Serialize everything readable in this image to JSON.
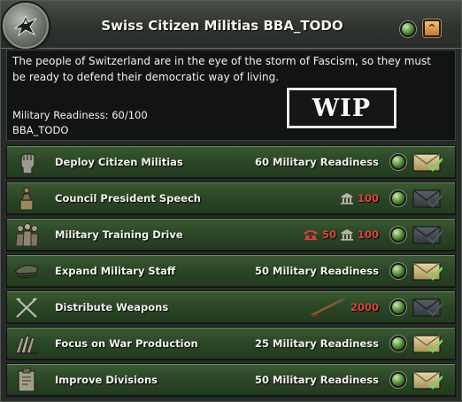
{
  "header": {
    "title": "Swiss Citizen Militias BBA_TODO",
    "emblem_icon": "eagle-emblem-icon",
    "status_orb_icon": "green-status-orb-icon",
    "collapse_icon": "chevron-up-icon",
    "collapse_glyph": "^"
  },
  "description": {
    "text": "The people of Switzerland are in the eye of the storm of Fascism, so they must be ready to defend their democratic way of living.",
    "readiness_line": "Military Readiness: 60/100",
    "tag": "BBA_TODO",
    "badge": "WIP"
  },
  "decisions": [
    {
      "label": "Deploy Citizen Militias",
      "icon": "raised-fist-icon",
      "cost_text": "60 Military Readiness",
      "costs": [],
      "available": true
    },
    {
      "label": "Council President Speech",
      "icon": "speaker-podium-icon",
      "cost_text": "",
      "costs": [
        {
          "icon": "political-power-icon",
          "value": "100"
        }
      ],
      "available": false
    },
    {
      "label": "Military Training Drive",
      "icon": "soldiers-group-icon",
      "cost_text": "",
      "costs": [
        {
          "icon": "telephone-icon",
          "value": "50"
        },
        {
          "icon": "political-power-icon",
          "value": "100"
        }
      ],
      "available": false
    },
    {
      "label": "Expand Military Staff",
      "icon": "officer-cap-icon",
      "cost_text": "50 Military Readiness",
      "costs": [],
      "available": true
    },
    {
      "label": "Distribute Weapons",
      "icon": "crossed-rifles-icon",
      "cost_text": "",
      "costs": [
        {
          "icon": "rifle-icon",
          "value": "2000"
        }
      ],
      "available": false
    },
    {
      "label": "Focus on War Production",
      "icon": "factory-tools-icon",
      "cost_text": "25 Military Readiness",
      "costs": [],
      "available": true
    },
    {
      "label": "Improve Divisions",
      "icon": "clipboard-icon",
      "cost_text": "50 Military Readiness",
      "costs": [],
      "available": true
    }
  ],
  "colors": {
    "row_green": "#2f4c2a",
    "cost_red": "#e0403a",
    "envelope_available": "#c9b98a",
    "envelope_unavailable": "#4a4f55",
    "check_green": "#7fd15a"
  }
}
